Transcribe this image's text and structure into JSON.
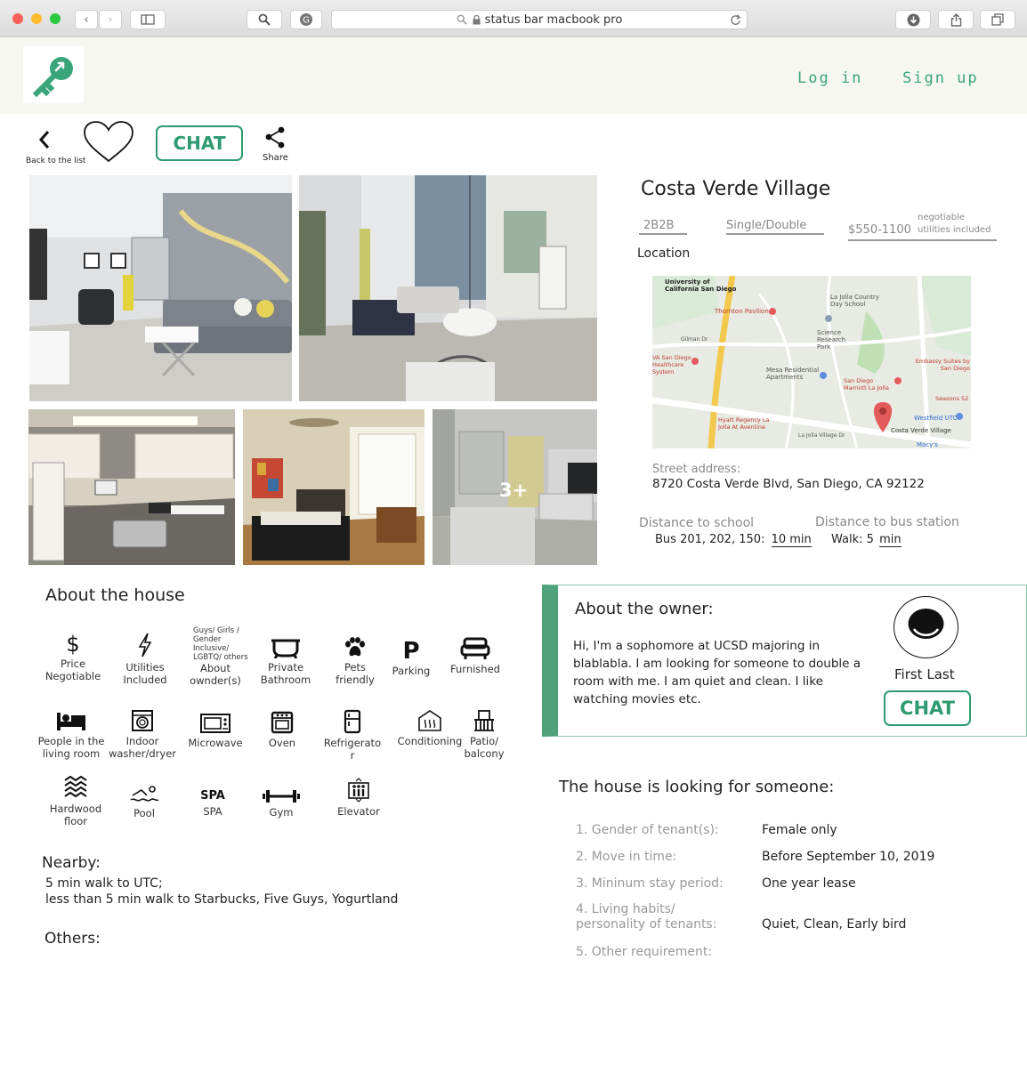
{
  "browser": {
    "url": "status bar macbook pro"
  },
  "header": {
    "login": "Log in",
    "signup": "Sign up"
  },
  "toolbar": {
    "back": "Back to the list",
    "chat": "CHAT",
    "share": "Share"
  },
  "photos": {
    "more": "3+"
  },
  "listing": {
    "title": "Costa Verde Village",
    "room_type": "2B2B",
    "occupancy": "Single/Double",
    "price": "$550-1100",
    "price_note_1": "negotiable",
    "price_note_2": "utilities included",
    "location_label": "Location",
    "street_label": "Street address:",
    "street": "8720 Costa Verde Blvd, San Diego, CA 92122",
    "school_label": "Distance to school",
    "school_prefix": "Bus 201, 202, 150:",
    "school_time": "10 min",
    "bus_label": "Distance to bus station",
    "bus_prefix": "Walk: 5",
    "bus_time": "min"
  },
  "map": {
    "labels": [
      "University of California San Diego",
      "Thornton Pavilion",
      "La Jolla Country Day School",
      "Science Research Park",
      "Gilman Dr",
      "VA San Diego Healthcare System",
      "Mesa Residential Apartments",
      "Embassy Suites by San Diego",
      "San Diego Marriott La Jolla",
      "Seasons 52",
      "Hyatt Regency La Jolla At Aventine",
      "Westfield UTC",
      "Costa Verde Village",
      "Macy's",
      "La Jolla Village Dr"
    ]
  },
  "about_house": {
    "title": "About the house",
    "amenities": [
      {
        "label": "Price Negotiable",
        "icon": "dollar-icon"
      },
      {
        "label": "Utilities Included",
        "icon": "lightning-icon"
      },
      {
        "label": "Guys/ Girls / Gender Inclusive/ LGBTQ/ others",
        "label2": "About ownder(s)",
        "icon": "none"
      },
      {
        "label": "Private Bathroom",
        "icon": "bathtub-icon"
      },
      {
        "label": "Pets friendly",
        "icon": "paw-icon"
      },
      {
        "label": "Parking",
        "icon": "parking-icon"
      },
      {
        "label": "Furnished",
        "icon": "sofa-icon"
      },
      {
        "label": "People in the living room",
        "icon": "bed-icon"
      },
      {
        "label": "Indoor washer/dryer",
        "icon": "washer-icon"
      },
      {
        "label": "Microwave",
        "icon": "microwave-icon"
      },
      {
        "label": "Oven",
        "icon": "oven-icon"
      },
      {
        "label": "Refrigerator",
        "icon": "fridge-icon"
      },
      {
        "label": "Conditioning",
        "icon": "ac-icon"
      },
      {
        "label": "Patio/ balcony",
        "icon": "balcony-icon"
      },
      {
        "label": "Hardwood floor",
        "icon": "hardwood-icon"
      },
      {
        "label": "Pool",
        "icon": "swim-icon"
      },
      {
        "label": "SPA",
        "icon": "spa-icon"
      },
      {
        "label": "Gym",
        "icon": "dumbbell-icon"
      },
      {
        "label": "Elevator",
        "icon": "elevator-icon"
      }
    ],
    "spa_glyph": "SPA",
    "nearby_title": "Nearby:",
    "nearby_1": "5 min walk to UTC;",
    "nearby_2": "less than 5 min walk to Starbucks, Five Guys, Yogurtland",
    "others_title": "Others:"
  },
  "owner": {
    "title": "About the owner:",
    "bio": "Hi, I'm a sophomore at UCSD majoring in blablabla.  I am looking for someone to double a room with me. I am quiet and clean. I like watching movies etc.",
    "name": "First Last",
    "chat": "CHAT"
  },
  "looking": {
    "title": "The house is looking for someone:",
    "rows": [
      {
        "key": "1. Gender of tenant(s):",
        "value": "Female only"
      },
      {
        "key": "2. Move in time:",
        "value": "Before September 10, 2019"
      },
      {
        "key": "3. Mininum stay period:",
        "value": "One year lease"
      },
      {
        "key": "4. Living habits/ personality of tenants:",
        "value": "Quiet, Clean, Early bird"
      },
      {
        "key": "5. Other requirement:",
        "value": ""
      }
    ]
  }
}
